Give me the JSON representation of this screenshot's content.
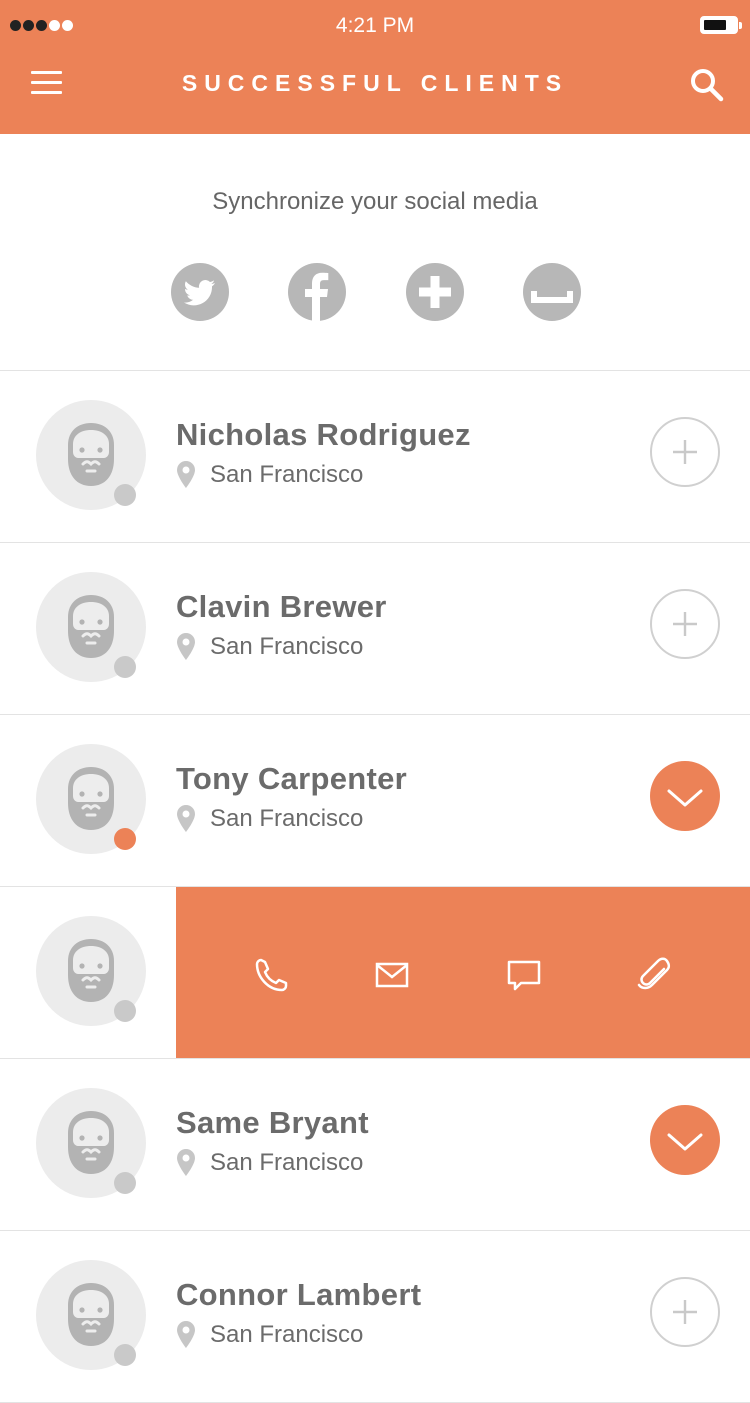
{
  "status_bar": {
    "time": "4:21 PM",
    "signal_filled": 3,
    "signal_empty": 2,
    "battery_level": 0.65
  },
  "header": {
    "title": "SUCCESSFUL CLIENTS",
    "menu_icon": "menu-icon",
    "search_icon": "search-icon"
  },
  "sync": {
    "text": "Synchronize your social media",
    "networks": [
      {
        "icon": "twitter-icon"
      },
      {
        "icon": "facebook-icon"
      },
      {
        "icon": "google-plus-icon"
      },
      {
        "icon": "other-network-icon"
      }
    ]
  },
  "clients": [
    {
      "name": "Nicholas Rodriguez",
      "location": "San Francisco",
      "status": "offline",
      "action": "add"
    },
    {
      "name": "Clavin Brewer",
      "location": "San Francisco",
      "status": "offline",
      "action": "add"
    },
    {
      "name": "Tony Carpenter",
      "location": "San Francisco",
      "status": "online",
      "action": "expand"
    },
    {
      "name": "",
      "location": "",
      "status": "offline",
      "action": "swiped",
      "swipe_actions": [
        "phone-icon",
        "mail-icon",
        "chat-icon",
        "attachment-icon"
      ]
    },
    {
      "name": "Same Bryant",
      "location": "San Francisco",
      "status": "offline",
      "action": "expand"
    },
    {
      "name": "Connor Lambert",
      "location": "San Francisco",
      "status": "offline",
      "action": "add"
    }
  ],
  "colors": {
    "accent": "#ec8257",
    "icon_gray": "#b7b7b7",
    "avatar_bg": "#ececec",
    "status_offline": "#c9c9c9"
  }
}
